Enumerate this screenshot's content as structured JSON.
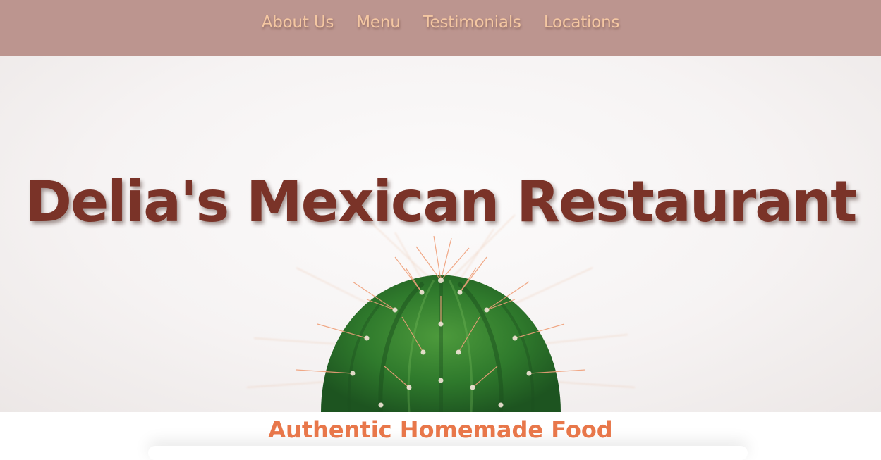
{
  "nav": {
    "items": [
      {
        "label": "About Us"
      },
      {
        "label": "Menu"
      },
      {
        "label": "Testimonials"
      },
      {
        "label": "Locations"
      }
    ]
  },
  "hero": {
    "title": "Delia's Mexican Restaurant",
    "image": "cactus-photo"
  },
  "tagline": "Authentic Homemade Food",
  "colors": {
    "nav_background": "#bc958f",
    "nav_text": "#f4c7a2",
    "title_text": "#7a3328",
    "tagline_text": "#e8774a"
  }
}
